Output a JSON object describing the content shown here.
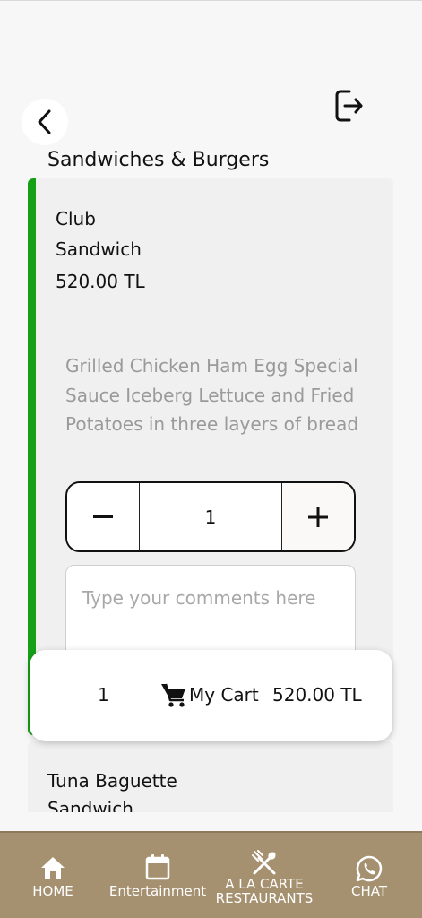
{
  "header": {
    "back_icon": "chevron-left-icon",
    "logout_icon": "logout-icon",
    "section_title": "Sandwiches & Burgers"
  },
  "items": [
    {
      "name_line1": "Club",
      "name_line2": "Sandwich",
      "price": "520.00 TL",
      "description": "Grilled Chicken Ham Egg Special Sauce Iceberg Lettuce and Fried Potatoes in three layers of bread",
      "quantity": "1",
      "comment_placeholder": "Type your comments here",
      "selected_accent": "#16a016"
    },
    {
      "name_line1": "Tuna Baguette",
      "name_line2": "Sandwich"
    }
  ],
  "cart": {
    "count": "1",
    "label": "My Cart",
    "total": "520.00 TL",
    "icon": "cart-icon"
  },
  "nav": {
    "background": "#a5906f",
    "items": [
      {
        "label": "HOME",
        "icon": "home-icon"
      },
      {
        "label": "Entertainment",
        "icon": "calendar-icon"
      },
      {
        "label_line1": "A LA CARTE",
        "label_line2": "RESTAURANTS",
        "icon": "fork-knife-icon"
      },
      {
        "label": "CHAT",
        "icon": "whatsapp-icon"
      }
    ]
  }
}
